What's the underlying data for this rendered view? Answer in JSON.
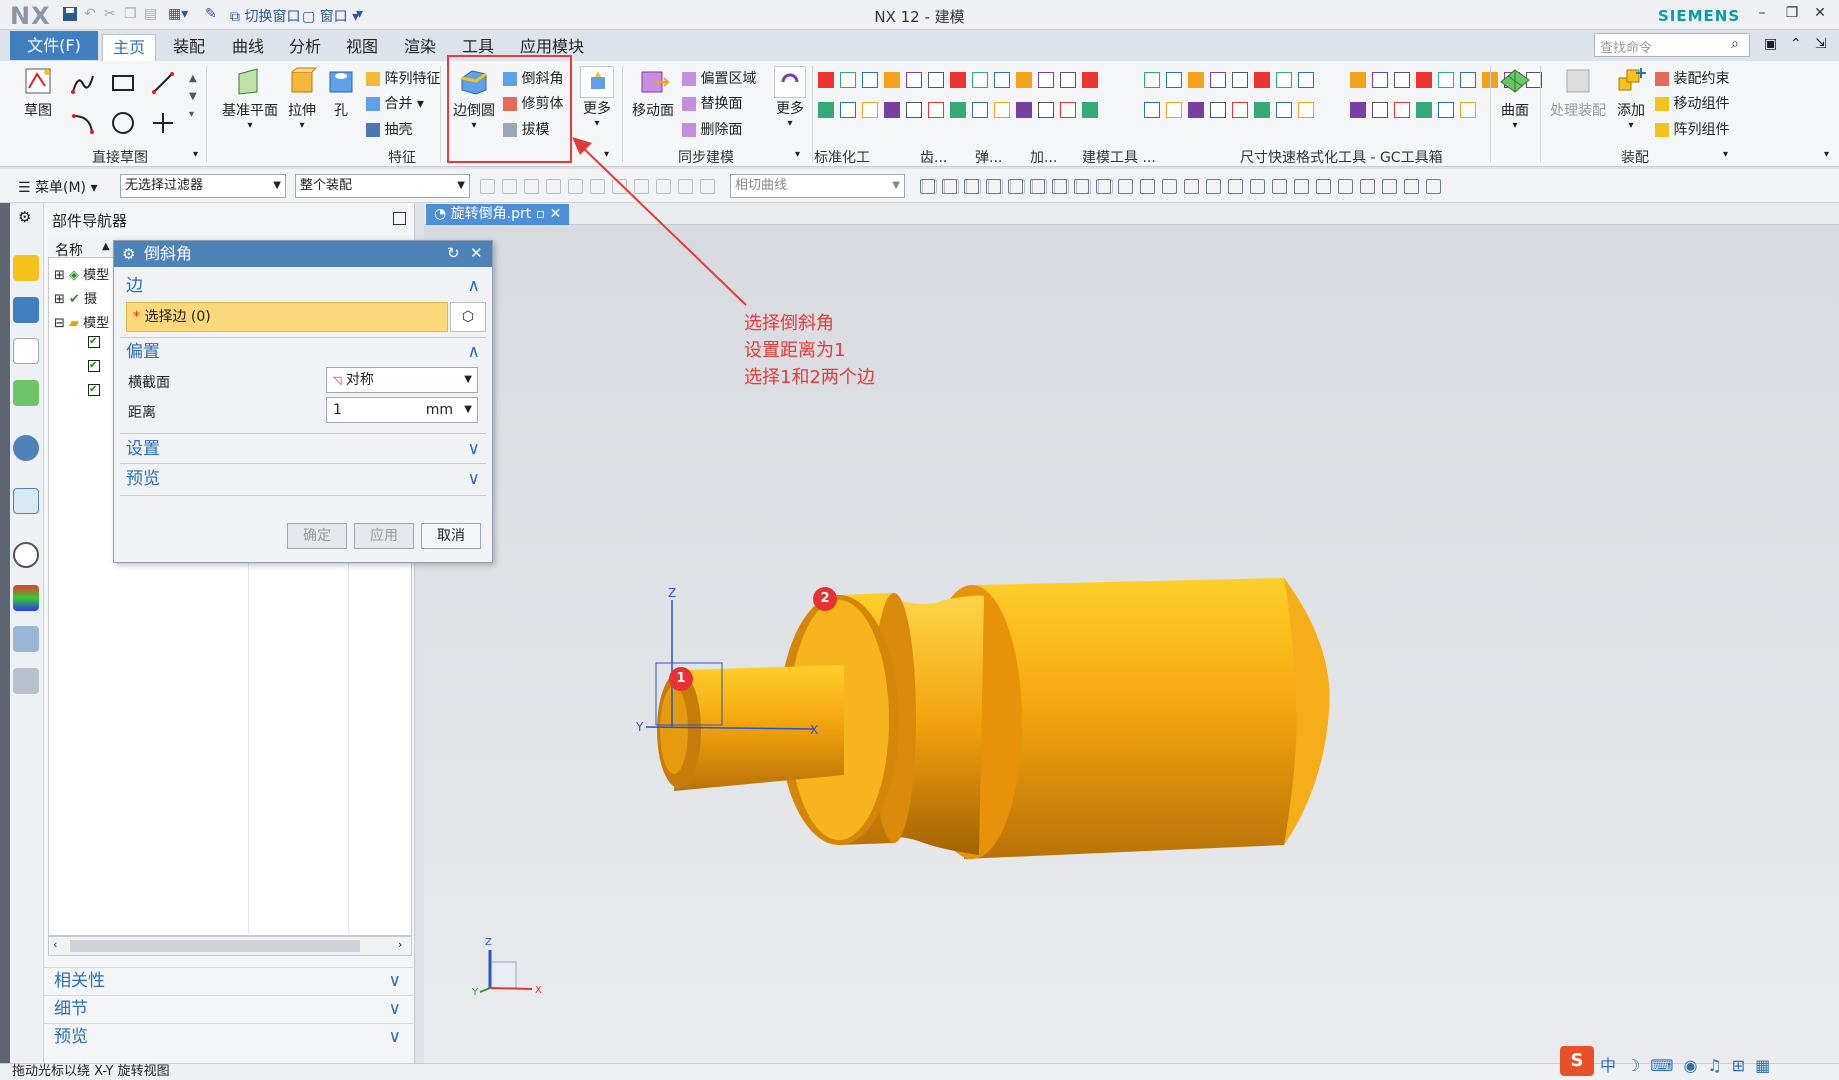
{
  "app": {
    "logo": "NX",
    "title": "NX 12 - 建模",
    "brand": "SIEMENS",
    "quick_access": {
      "switch_window": "切换窗口",
      "window": "窗口"
    }
  },
  "menubar": {
    "file": "文件(F)",
    "tabs": [
      "主页",
      "装配",
      "曲线",
      "分析",
      "视图",
      "渲染",
      "工具",
      "应用模块"
    ],
    "active_tab": "主页",
    "search_placeholder": "查找命令"
  },
  "ribbon": {
    "direct_sketch": {
      "sketch": "草图",
      "group": "直接草图"
    },
    "feature": {
      "datum_plane": "基准平面",
      "extrude": "拉伸",
      "hole": "孔",
      "pattern": "阵列特征",
      "unite": "合并",
      "shell": "抽壳",
      "group": "特征"
    },
    "edge_blend": {
      "blend": "边倒圆",
      "chamfer": "倒斜角",
      "trim_body": "修剪体",
      "draft": "拔模",
      "more": "更多"
    },
    "sync": {
      "move_face": "移动面",
      "offset_region": "偏置区域",
      "replace_face": "替换面",
      "delete_face": "删除面",
      "more": "更多",
      "group": "同步建模"
    },
    "other_groups": [
      "标准化工具...",
      "齿...",
      "弹...",
      "加...",
      "建模工具 ...",
      "尺寸快速格式化工具 - GC工具箱"
    ],
    "surface": {
      "label": "曲面"
    },
    "assembly": {
      "process": "处理装配",
      "add": "添加",
      "constraint": "装配约束",
      "move_component": "移动组件",
      "pattern_component": "阵列组件",
      "group": "装配"
    }
  },
  "toolbar2": {
    "menu": "菜单(M)",
    "filter": "无选择过滤器",
    "scope": "整个装配",
    "curve_rule": "相切曲线"
  },
  "navigator": {
    "title": "部件导航器",
    "col_name": "名称",
    "rows": [
      "模型",
      "摄",
      "模型"
    ],
    "sections": [
      "相关性",
      "细节",
      "预览"
    ]
  },
  "file_tab": {
    "label": "旋转倒角.prt"
  },
  "dialog": {
    "title": "倒斜角",
    "edge_section": "边",
    "select_edge": "选择边 (0)",
    "offset_section": "偏置",
    "cross_section_label": "横截面",
    "cross_section_value": "对称",
    "distance_label": "距离",
    "distance_value": "1",
    "distance_unit": "mm",
    "settings": "设置",
    "preview": "预览",
    "ok": "确定",
    "apply": "应用",
    "cancel": "取消"
  },
  "annotation": {
    "text": "选择倒斜角\n设置距离为1\n选择1和2两个边"
  },
  "markers": [
    "1",
    "2"
  ],
  "axes": {
    "z": "Z",
    "y": "Y",
    "x": "X"
  },
  "status": {
    "text": "拖动光标以绕 X-Y 旋转视图"
  },
  "colors": {
    "accent": "#2a6fb8",
    "part": "#f2a91a",
    "annotation": "#e33b3b"
  }
}
